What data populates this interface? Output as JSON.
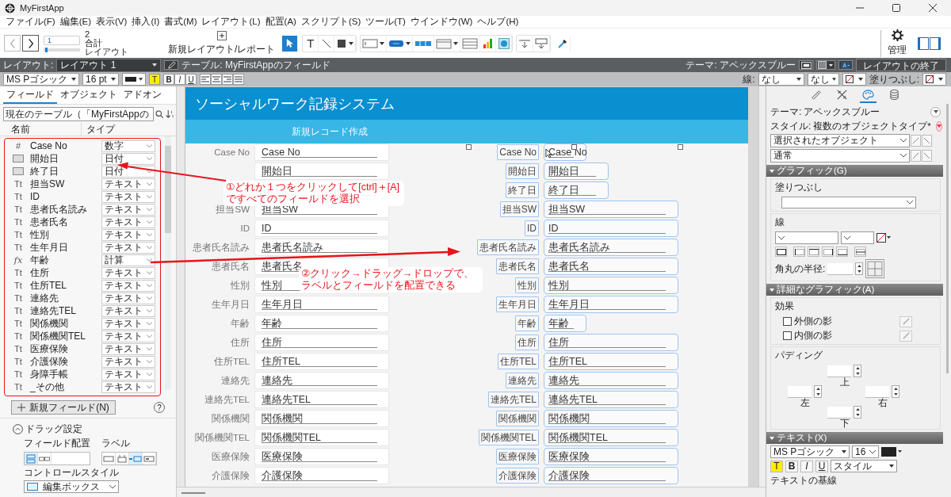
{
  "window": {
    "title": "MyFirstApp"
  },
  "menu": [
    "ファイル(F)",
    "編集(E)",
    "表示(V)",
    "挿入(I)",
    "書式(M)",
    "レイアウト(L)",
    "配置(A)",
    "スクリプト(S)",
    "ツール(T)",
    "ウインドウ(W)",
    "ヘルプ(H)"
  ],
  "toolbar": {
    "record_current": "1",
    "record_total": "2",
    "record_total_label": "合計",
    "record_unit": "レイアウト",
    "level": 0.05,
    "new_layout": "新規レイアウト/レポート",
    "manage": "管理",
    "tool_groups": [
      [
        {
          "kind": "pointer",
          "selected": true
        }
      ],
      [
        {
          "kind": "text",
          "glyph": "T",
          "selected": false
        },
        {
          "kind": "line",
          "selected": false
        },
        {
          "kind": "shape",
          "selected": false,
          "menu": true
        }
      ],
      [
        {
          "kind": "field",
          "selected": false,
          "menu": true
        },
        {
          "kind": "button",
          "selected": false,
          "menu": true
        },
        {
          "kind": "popover",
          "selected": false
        },
        {
          "kind": "tabpanel",
          "selected": false,
          "menu": true
        },
        {
          "kind": "portal",
          "selected": false
        },
        {
          "kind": "chart",
          "selected": false
        },
        {
          "kind": "webviewer",
          "selected": false
        }
      ],
      [
        {
          "kind": "part",
          "selected": false
        },
        {
          "kind": "partsetup",
          "selected": false
        }
      ],
      [
        {
          "kind": "eyedropper",
          "selected": false
        }
      ]
    ]
  },
  "layout_bar": {
    "label": "レイアウト:",
    "layout": "レイアウト 1",
    "table": "テーブル: MyFirstAppのフィールド",
    "theme": "テーマ: アペックスブルー",
    "exit": "レイアウトの終了"
  },
  "format_bar": {
    "font": "MS Pゴシック",
    "size": "16 pt",
    "highlight": "T",
    "styles": [
      "B",
      "I",
      "U"
    ],
    "line_label": "線:",
    "line_style": "なし",
    "line_width": "なし",
    "fill_label": "塗りつぶし:"
  },
  "fields_panel": {
    "tabs": [
      {
        "label": "フィールド",
        "selected": true
      },
      {
        "label": "オブジェクト",
        "selected": false
      },
      {
        "label": "アドオン",
        "selected": false
      }
    ],
    "table_select": "現在のテーブル（「MyFirstAppの",
    "columns": [
      "名前",
      "タイプ"
    ],
    "fields": [
      {
        "kind": "number",
        "icon": "#",
        "name": "Case No",
        "type": "数字"
      },
      {
        "kind": "date",
        "name": "開始日",
        "type": "日付"
      },
      {
        "kind": "date",
        "name": "終了日",
        "type": "日付"
      },
      {
        "kind": "text",
        "icon": "Tt",
        "name": "担当SW",
        "type": "テキスト"
      },
      {
        "kind": "text",
        "icon": "Tt",
        "name": "ID",
        "type": "テキスト"
      },
      {
        "kind": "text",
        "icon": "Tt",
        "name": "患者氏名読み",
        "type": "テキスト"
      },
      {
        "kind": "text",
        "icon": "Tt",
        "name": "患者氏名",
        "type": "テキスト"
      },
      {
        "kind": "text",
        "icon": "Tt",
        "name": "性別",
        "type": "テキスト"
      },
      {
        "kind": "text",
        "icon": "Tt",
        "name": "生年月日",
        "type": "テキスト"
      },
      {
        "kind": "calc",
        "icon": "fx",
        "name": "年齢",
        "type": "計算"
      },
      {
        "kind": "text",
        "icon": "Tt",
        "name": "住所",
        "type": "テキスト"
      },
      {
        "kind": "text",
        "icon": "Tt",
        "name": "住所TEL",
        "type": "テキスト"
      },
      {
        "kind": "text",
        "icon": "Tt",
        "name": "連絡先",
        "type": "テキスト"
      },
      {
        "kind": "text",
        "icon": "Tt",
        "name": "連絡先TEL",
        "type": "テキスト"
      },
      {
        "kind": "text",
        "icon": "Tt",
        "name": "関係機関",
        "type": "テキスト"
      },
      {
        "kind": "text",
        "icon": "Tt",
        "name": "関係機関TEL",
        "type": "テキスト"
      },
      {
        "kind": "text",
        "icon": "Tt",
        "name": "医療保険",
        "type": "テキスト"
      },
      {
        "kind": "text",
        "icon": "Tt",
        "name": "介護保険",
        "type": "テキスト"
      },
      {
        "kind": "text",
        "icon": "Tt",
        "name": "身障手帳",
        "type": "テキスト"
      },
      {
        "kind": "text",
        "icon": "Tt",
        "name": "_その他",
        "type": "テキスト"
      }
    ],
    "new_field": "新規フィールド(N)",
    "help": "?",
    "drag_title": "ドラッグ設定",
    "expanded": true,
    "placement_label": "フィールド配置",
    "placements": [
      {
        "kind": "vertical",
        "selected": true
      },
      {
        "kind": "horizontal",
        "selected": false
      }
    ],
    "label_label": "ラベル",
    "label_positions": [
      {
        "kind": "none",
        "selected": false
      },
      {
        "kind": "top",
        "selected": false
      },
      {
        "kind": "left",
        "selected": true
      },
      {
        "kind": "inside",
        "selected": false
      }
    ],
    "control_style_label": "コントロールスタイル",
    "control_style": "編集ボックス"
  },
  "layout": {
    "title": "ソーシャルワーク記録システム",
    "subtitle": "新規レコード作成",
    "left_rows": [
      {
        "label": "Case No",
        "value": "Case No"
      },
      {
        "value": "開始日"
      },
      {},
      {
        "label": "担当SW",
        "value": "担当SW"
      },
      {
        "label": "ID",
        "value": "ID"
      },
      {
        "label": "患者氏名読み",
        "value": "患者氏名読み"
      },
      {
        "label": "患者氏名",
        "value": "患者氏名"
      },
      {
        "label": "性別",
        "value": "性別"
      },
      {
        "label": "生年月日",
        "value": "生年月日"
      },
      {
        "label": "年齢",
        "value": "年齢"
      },
      {
        "label": "住所",
        "value": "住所"
      },
      {
        "label": "住所TEL",
        "value": "住所TEL"
      },
      {
        "label": "連絡先",
        "value": "連絡先"
      },
      {
        "label": "連絡先TEL",
        "value": "連絡先TEL"
      },
      {
        "label": "関係機関",
        "value": "関係機関"
      },
      {
        "label": "関係機関TEL",
        "value": "関係機関TEL"
      },
      {
        "label": "医療保険",
        "value": "医療保険"
      },
      {
        "label": "介護保険",
        "value": "介護保険"
      }
    ],
    "right_rows": [
      {
        "label": "Case No",
        "value": "Case No",
        "kind": "short"
      },
      {
        "label": "開始日",
        "value": "開始日",
        "kind": "medium"
      },
      {
        "label": "終了日",
        "value": "終了日",
        "kind": "medium"
      },
      {
        "label": "担当SW",
        "value": "担当SW",
        "kind": "full"
      },
      {
        "label": "ID",
        "value": "ID",
        "kind": "full"
      },
      {
        "label": "患者氏名読み",
        "value": "患者氏名読み",
        "kind": "full"
      },
      {
        "label": "患者氏名",
        "value": "患者氏名",
        "kind": "full"
      },
      {
        "label": "性別",
        "value": "性別",
        "kind": "full"
      },
      {
        "label": "生年月日",
        "value": "生年月日",
        "kind": "full"
      },
      {
        "label": "年齢",
        "value": "年齢",
        "kind": "short"
      },
      {
        "label": "住所",
        "value": "住所",
        "kind": "full"
      },
      {
        "label": "住所TEL",
        "value": "住所TEL",
        "kind": "full"
      },
      {
        "label": "連絡先",
        "value": "連絡先",
        "kind": "full"
      },
      {
        "label": "連絡先TEL",
        "value": "連絡先TEL",
        "kind": "full"
      },
      {
        "label": "関係機関",
        "value": "関係機関",
        "kind": "full"
      },
      {
        "label": "関係機関TEL",
        "value": "関係機関TEL",
        "kind": "full"
      },
      {
        "label": "医療保険",
        "value": "医療保険",
        "kind": "full"
      },
      {
        "label": "介護保険",
        "value": "介護保険",
        "kind": "full"
      }
    ]
  },
  "annotations": [
    {
      "text": "①どれか１つをクリックして[ctrl]＋[A]ですべてのフィールドを選択"
    },
    {
      "text": "②クリック→ドラッグ→ドロップで、ラベルとフィールドを配置できる"
    }
  ],
  "inspector": {
    "tabs": [
      {
        "kind": "position",
        "selected": false
      },
      {
        "kind": "tools",
        "selected": false
      },
      {
        "kind": "appearance",
        "selected": true
      },
      {
        "kind": "data",
        "selected": false
      }
    ],
    "theme_label": "テーマ:",
    "theme": "アペックスブルー",
    "style_label": "スタイル:",
    "style": "複数のオブジェクトタイプ*",
    "object_select": "選択されたオブジェクト",
    "state_select": "通常",
    "graphic_title": "グラフィック(G)",
    "fill_label": "塗りつぶし",
    "line_label": "線",
    "radius_label": "角丸の半径:",
    "advanced_title": "詳細なグラフィック(A)",
    "effects_label": "効果",
    "effects": [
      {
        "label": "外側の影",
        "checked": false
      },
      {
        "label": "内側の影",
        "checked": false
      }
    ],
    "padding_label": "パディング",
    "padding_sides": [
      "上",
      "左",
      "右",
      "下"
    ],
    "text_title": "テキスト(X)",
    "font": "MS Pゴシック",
    "size": "16",
    "highlight": "T",
    "styles": [
      "B",
      "I",
      "U"
    ],
    "style_select": "スタイル",
    "baseline_label": "テキストの基線"
  }
}
